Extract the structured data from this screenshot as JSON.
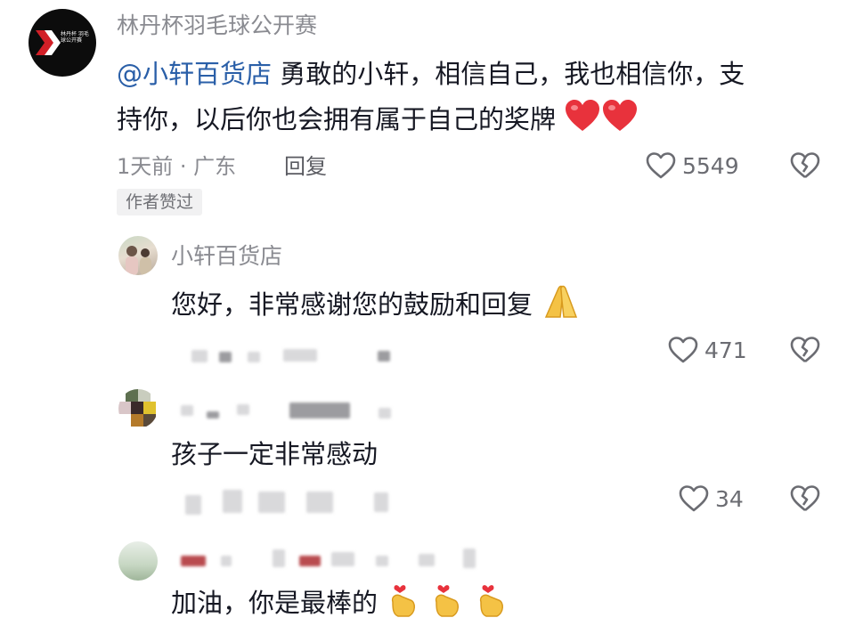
{
  "comment": {
    "author": "林丹杯羽毛球公开赛",
    "avatar_logo_text": "林丹杯 羽毛球公开赛",
    "mention": "@小轩百货店",
    "text_line1": " 勇敢的小轩，相信自己，我也相信你，支",
    "text_line2": "持你，以后你也会拥有属于自己的奖牌",
    "time_location": "1天前 · 广东",
    "reply_label": "回复",
    "like_count": "5549",
    "badge": "作者赞过"
  },
  "replies": [
    {
      "author": "小轩百货店",
      "text": "您好，非常感谢您的鼓励和回复",
      "like_count": "471"
    },
    {
      "author": "",
      "text": "孩子一定非常感动",
      "like_count": "34"
    },
    {
      "author": "",
      "text": "加油，你是最棒的"
    }
  ],
  "icons": {
    "like": "heart-outline-icon",
    "dislike": "broken-heart-icon",
    "red_heart": "red-heart-emoji",
    "pray": "folded-hands-emoji",
    "finger_heart": "finger-heart-emoji"
  },
  "colors": {
    "mention": "#2a5fa8",
    "heart_red": "#e8323c",
    "text": "#161823",
    "muted": "#8a8b91"
  }
}
